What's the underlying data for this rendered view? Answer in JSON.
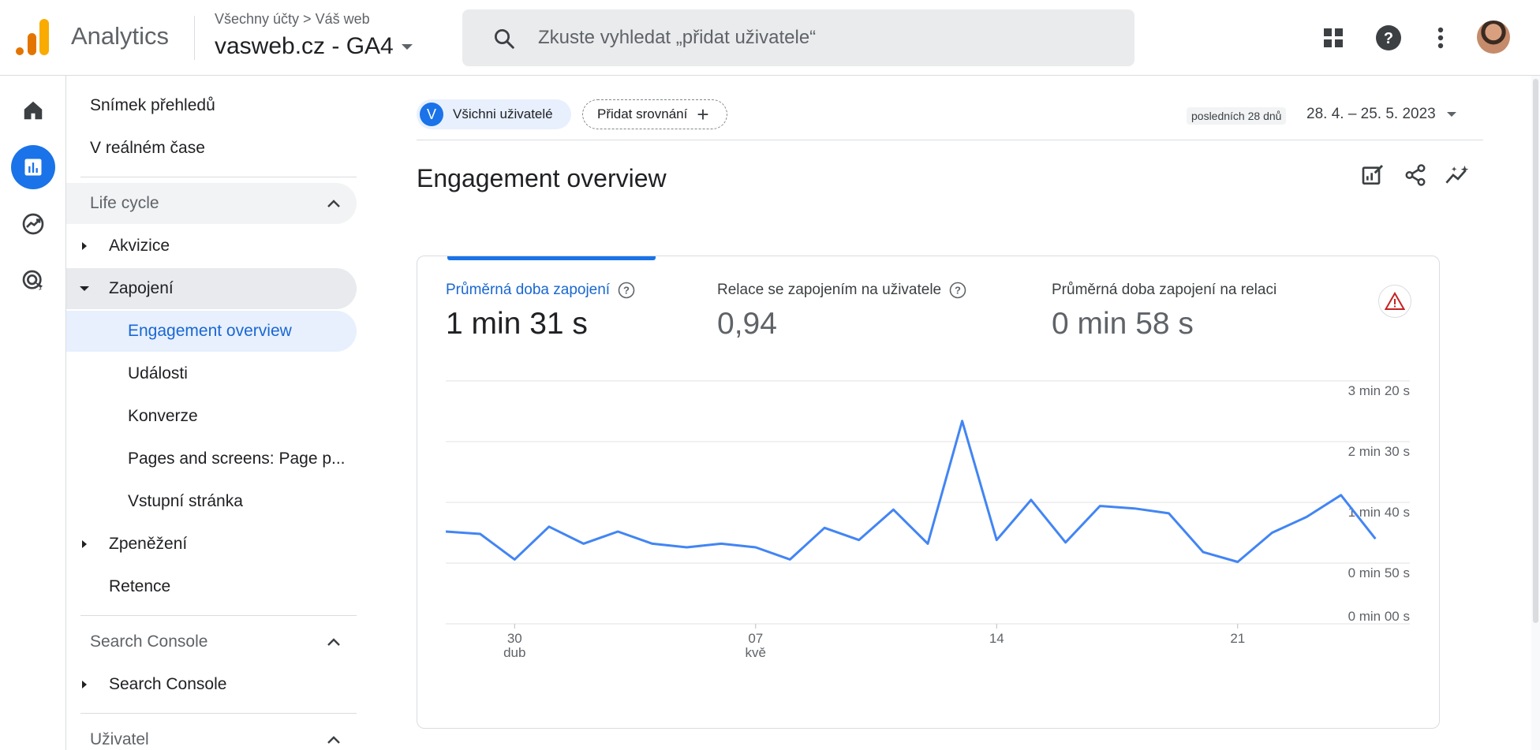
{
  "header": {
    "app_title": "Analytics",
    "breadcrumb": "Všechny účty > Váš web",
    "property": "vasweb.cz - GA4",
    "search_placeholder": "Zkuste vyhledat „přidat uživatele“",
    "icons": [
      "apps-grid-icon",
      "help-icon",
      "more-vert-icon",
      "avatar"
    ]
  },
  "rail": {
    "items": [
      "home-icon",
      "reports-icon",
      "explore-icon",
      "advertising-icon"
    ],
    "active": "reports-icon"
  },
  "nav": {
    "top": [
      "Snímek přehledů",
      "V reálném čase"
    ],
    "lifecycle": {
      "title": "Life cycle",
      "items": {
        "acquisition": "Akvizice",
        "engagement": "Zapojení",
        "engagement_children": [
          "Engagement overview",
          "Události",
          "Konverze",
          "Pages and screens: Page p...",
          "Vstupní stránka"
        ],
        "monetization": "Zpeněžení",
        "retention": "Retence"
      }
    },
    "search_console": {
      "title": "Search Console",
      "item": "Search Console"
    },
    "user": {
      "title": "Uživatel"
    }
  },
  "main": {
    "segment_chip": {
      "initial": "V",
      "label": "Všichni uživatelé"
    },
    "compare_chip": {
      "label": "Přidat srovnání",
      "plus": "+"
    },
    "range_tag": "posledních 28 dnů",
    "range": "28. 4. – 25. 5. 2023",
    "title": "Engagement overview",
    "toolbar_icons": [
      "customize-report-icon",
      "share-icon",
      "insights-icon"
    ],
    "metrics": [
      {
        "label": "Průměrná doba zapojení",
        "value": "1 min 31 s",
        "active": true,
        "help": true
      },
      {
        "label": "Relace se zapojením na uživatele",
        "value": "0,94",
        "active": false,
        "help": true
      },
      {
        "label": "Průměrná doba zapojení na relaci",
        "value": "0 min 58 s",
        "active": false,
        "help": false
      }
    ],
    "accent_color": "#1a73e8",
    "warning_color": "#c5221f"
  },
  "chart_data": {
    "type": "line",
    "y_tick_labels": [
      "0 min 00 s",
      "0 min 50 s",
      "1 min 40 s",
      "2 min 30 s",
      "3 min 20 s"
    ],
    "y_ticks_seconds": [
      0,
      50,
      100,
      150,
      200
    ],
    "ylim": [
      0,
      200
    ],
    "x_tick_labels": [
      {
        "day": "30",
        "month": "dub",
        "index": 2
      },
      {
        "day": "07",
        "month": "kvě",
        "index": 9
      },
      {
        "day": "14",
        "month": "",
        "index": 16
      },
      {
        "day": "21",
        "month": "",
        "index": 23
      }
    ],
    "x": [
      "2023-04-28",
      "2023-04-29",
      "2023-04-30",
      "2023-05-01",
      "2023-05-02",
      "2023-05-03",
      "2023-05-04",
      "2023-05-05",
      "2023-05-06",
      "2023-05-07",
      "2023-05-08",
      "2023-05-09",
      "2023-05-10",
      "2023-05-11",
      "2023-05-12",
      "2023-05-13",
      "2023-05-14",
      "2023-05-15",
      "2023-05-16",
      "2023-05-17",
      "2023-05-18",
      "2023-05-19",
      "2023-05-20",
      "2023-05-21",
      "2023-05-22",
      "2023-05-23",
      "2023-05-24",
      "2023-05-25",
      "2023-05-26"
    ],
    "series": [
      {
        "values": [
          76,
          74,
          53,
          80,
          66,
          76,
          66,
          63,
          66,
          63,
          53,
          79,
          69,
          94,
          66,
          167,
          69,
          102,
          67,
          97,
          95,
          91,
          59,
          51,
          75,
          88,
          106,
          70
        ],
        "color": "#4285f4"
      }
    ],
    "grid": true
  }
}
